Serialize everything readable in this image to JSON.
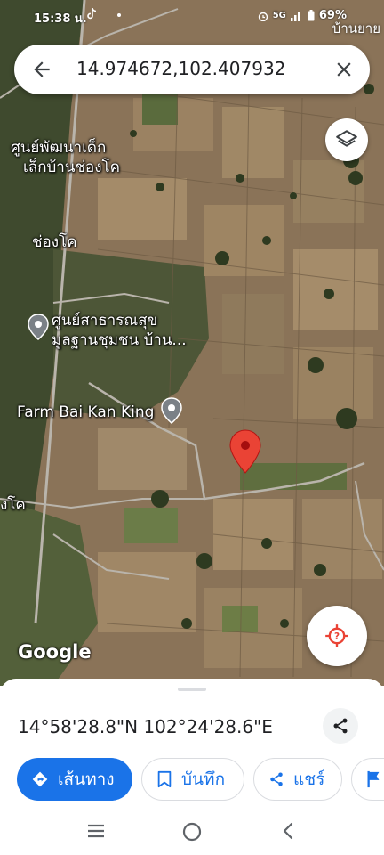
{
  "status_bar": {
    "time": "15:38 น.",
    "network": "5G",
    "battery": "69%",
    "edge_place": "บ้านยาย"
  },
  "search": {
    "query": "14.974672,102.407932",
    "back_icon": "arrow-back-icon",
    "close_icon": "close-icon"
  },
  "map": {
    "labels": {
      "center_school_line1": "ศูนย์พัฒนาเด็ก",
      "center_school_line2": "เล็กบ้านช่องโค",
      "village": "ช่องโค",
      "health_center_line1": "ศูนย์สาธารณสุข",
      "health_center_line2": "มูลฐานชุมชน บ้าน...",
      "farm": "Farm Bai Kan King",
      "edge_left": "งโค"
    },
    "attribution": "Google",
    "pin_color": "#ea4335"
  },
  "sheet": {
    "coordinates": "14°58'28.8\"N 102°24'28.6\"E",
    "actions": {
      "directions": "เส้นทาง",
      "save": "บันทึก",
      "share": "แชร์"
    }
  },
  "colors": {
    "accent": "#1a73e8"
  }
}
